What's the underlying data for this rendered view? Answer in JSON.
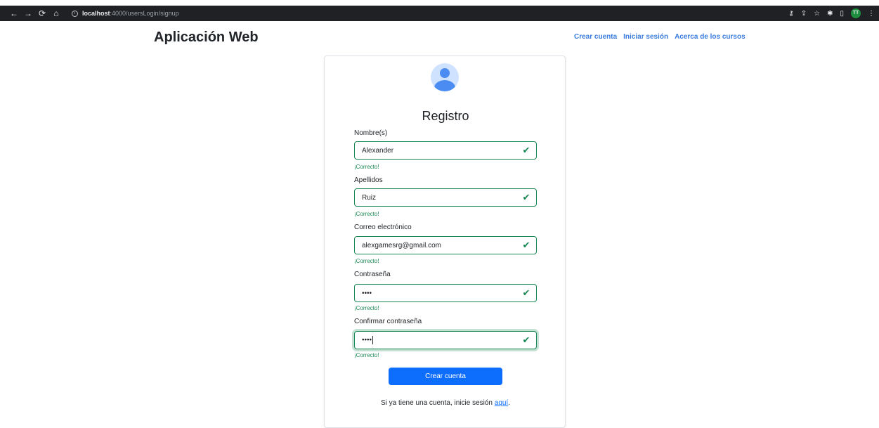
{
  "browser": {
    "url_host": "localhost",
    "url_path": ":4000/usersLogin/signup",
    "profile_initials": "TT",
    "icons": [
      "back-arrow-icon",
      "forward-arrow-icon",
      "reload-icon",
      "home-icon",
      "info-icon",
      "key-icon",
      "share-icon",
      "star-icon",
      "extensions-icon",
      "sidebar-icon",
      "menu-icon"
    ]
  },
  "navbar": {
    "brand": "Aplicación Web",
    "links": [
      "Crear cuenta",
      "Iniciar sesión",
      "Acerca de los cursos"
    ]
  },
  "form": {
    "title": "Registro",
    "fields": [
      {
        "label": "Nombre(s)",
        "value": "Alexander",
        "feedback": "¡Correcto!"
      },
      {
        "label": "Apellidos",
        "value": "Ruiz",
        "feedback": "¡Correcto!"
      },
      {
        "label": "Correo electrónico",
        "value": "alexgamesrg@gmail.com",
        "feedback": "¡Correcto!"
      },
      {
        "label": "Contraseña",
        "value": "••••",
        "feedback": "¡Correcto!"
      },
      {
        "label": "Confirmar contraseña",
        "value": "••••",
        "feedback": "¡Correcto!"
      }
    ],
    "submit_label": "Crear cuenta",
    "login_hint_prefix": "Si ya tiene una cuenta, inicie sesión ",
    "login_hint_link": "aquí",
    "login_hint_suffix": "."
  },
  "colors": {
    "valid": "#198754",
    "primary": "#0d6efd",
    "link": "#3b7ddd",
    "browser_bar": "#202124"
  }
}
